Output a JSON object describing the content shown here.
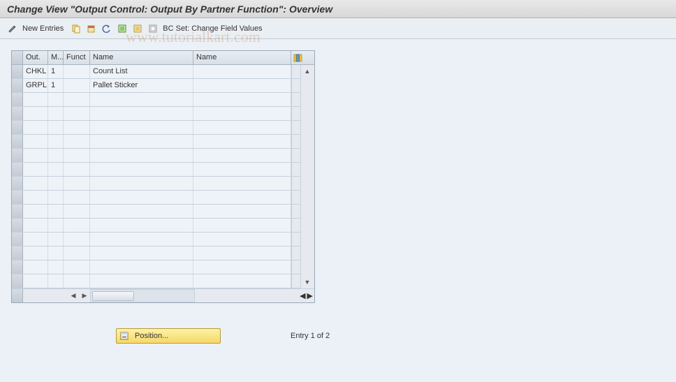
{
  "title": "Change View \"Output Control: Output By Partner Function\": Overview",
  "toolbar": {
    "new_entries_label": "New Entries",
    "bc_set_label": "BC Set: Change Field Values"
  },
  "grid": {
    "columns": {
      "out": "Out.",
      "m": "M...",
      "funct": "Funct",
      "name1": "Name",
      "name2": "Name"
    },
    "rows": [
      {
        "out": "CHKL",
        "m": "1",
        "funct": "",
        "name1": "Count List",
        "name2": ""
      },
      {
        "out": "GRPL",
        "m": "1",
        "funct": "",
        "name1": "Pallet Sticker",
        "name2": ""
      }
    ],
    "empty_rows": 14
  },
  "bottom": {
    "position_label": "Position...",
    "entry_text": "Entry 1 of 2"
  },
  "watermark": "www.tutorialkart.com"
}
